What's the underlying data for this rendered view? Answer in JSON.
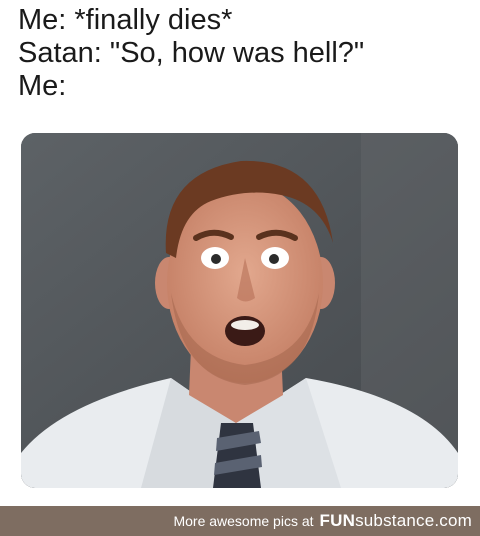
{
  "caption": {
    "line1": "Me: *finally dies*",
    "line2": "Satan: \"So, how was hell?\"",
    "line3": "Me:"
  },
  "footer": {
    "prefix": "More awesome pics at",
    "brand_bold": "FUN",
    "brand_rest": "substance.com"
  },
  "colors": {
    "footer_bg": "#7e6d61",
    "background": "#ffffff",
    "text": "#1a1a1a"
  }
}
